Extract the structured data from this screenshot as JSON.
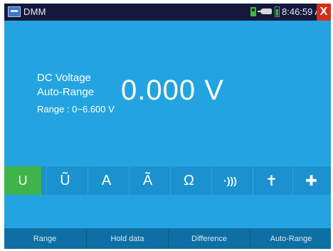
{
  "status_bar": {
    "app_title": "DMM",
    "time": "8:46:59 AM",
    "close_glyph": "X",
    "icons": [
      "dmm-app-icon",
      "sd-card-icon",
      "power-plug-icon",
      "battery-icon",
      "close-icon"
    ]
  },
  "readout": {
    "mode": "DC Voltage",
    "ranging": "Auto-Range",
    "range": "Range : 0~6.600 V",
    "value": "0.000 V"
  },
  "mode_buttons": [
    {
      "glyph": "U",
      "name": "dc-voltage",
      "active": true
    },
    {
      "glyph": "Ũ",
      "name": "ac-voltage",
      "active": false
    },
    {
      "glyph": "A",
      "name": "dc-current",
      "active": false
    },
    {
      "glyph": "Ã",
      "name": "ac-current",
      "active": false
    },
    {
      "glyph": "Ω",
      "name": "resistance",
      "active": false
    },
    {
      "glyph": "·)))",
      "name": "continuity",
      "active": false
    },
    {
      "glyph": "✝",
      "name": "diode",
      "active": false
    },
    {
      "glyph": "✚",
      "name": "capacitance",
      "active": false
    }
  ],
  "softkeys": [
    "Range",
    "Hold data",
    "Difference",
    "Auto-Range"
  ],
  "colors": {
    "background": "#23a4e0",
    "status_bar": "#15183b",
    "active_mode": "#3fb44a",
    "close": "#d32e1c",
    "softkey_bar": "#0d6fa3"
  }
}
